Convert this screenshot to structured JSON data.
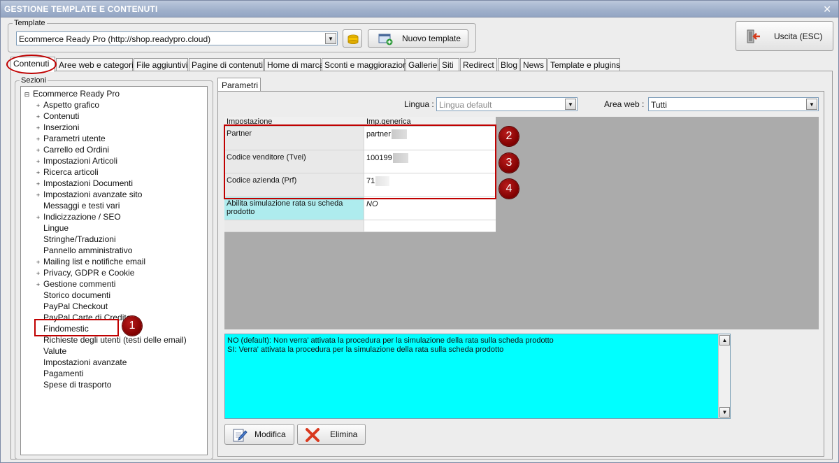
{
  "window": {
    "title": "GESTIONE TEMPLATE E CONTENUTI",
    "close_glyph": "✕"
  },
  "template_group": {
    "legend": "Template",
    "selected": "Ecommerce Ready Pro (http://shop.readypro.cloud)",
    "new_button": "Nuovo template"
  },
  "exit_button": "Uscita (ESC)",
  "tabs": [
    "Contenuti",
    "Aree web e categorie",
    "File aggiuntivi",
    "Pagine di contenuti",
    "Home di marca",
    "Sconti e maggiorazioni",
    "Gallerie",
    "Siti",
    "Redirect",
    "Blog",
    "News",
    "Template e plugins"
  ],
  "sections": {
    "legend": "Sezioni",
    "root": "Ecommerce Ready Pro",
    "items": [
      "Aspetto grafico",
      "Contenuti",
      "Inserzioni",
      "Parametri utente",
      "Carrello ed Ordini",
      "Impostazioni Articoli",
      "Ricerca articoli",
      "Impostazioni Documenti",
      "Impostazioni avanzate sito",
      "Messaggi e testi vari",
      "Indicizzazione / SEO",
      "Lingue",
      "Stringhe/Traduzioni",
      "Pannello amministrativo",
      "Mailing list e notifiche email",
      "Privacy, GDPR e Cookie",
      "Gestione commenti",
      "Storico documenti",
      "PayPal Checkout",
      "PayPal Carte di Credito",
      "Findomestic",
      "Richieste degli utenti (testi delle email)",
      "Valute",
      "Impostazioni avanzate",
      "Pagamenti",
      "Spese di trasporto"
    ],
    "selected": "Findomestic"
  },
  "params": {
    "tab": "Parametri",
    "lingua_label": "Lingua :",
    "lingua_value": "Lingua default",
    "area_label": "Area web :",
    "area_value": "Tutti",
    "col_setting": "Impostazione",
    "col_value": "Imp.generica",
    "rows": [
      {
        "name": "Partner",
        "value": "partner"
      },
      {
        "name": "Codice venditore (Tvei)",
        "value": "100199"
      },
      {
        "name": "Codice azienda (Prf)",
        "value": "71"
      },
      {
        "name": "Abilita simulazione rata su scheda prodotto",
        "value": "NO"
      },
      {
        "name": "",
        "value": ""
      }
    ]
  },
  "description": {
    "line1": "NO (default): Non verra' attivata la procedura per la simulazione della rata sulla scheda prodotto",
    "line2": "SI: Verra' attivata la procedura per la  simulazione della rata sulla scheda prodotto"
  },
  "actions": {
    "edit": "Modifica",
    "delete": "Elimina"
  },
  "callouts": [
    "1",
    "2",
    "3",
    "4"
  ],
  "colors": {
    "highlight_red": "#c00000",
    "desc_bg": "#00ffff",
    "row_cyan": "#aeecee",
    "grid_bg": "#ababab"
  },
  "icons": {
    "template_folder": "folder-icon",
    "new_template": "add-window-icon",
    "exit": "exit-door-icon",
    "edit": "edit-pencil-icon",
    "delete": "delete-x-icon"
  }
}
